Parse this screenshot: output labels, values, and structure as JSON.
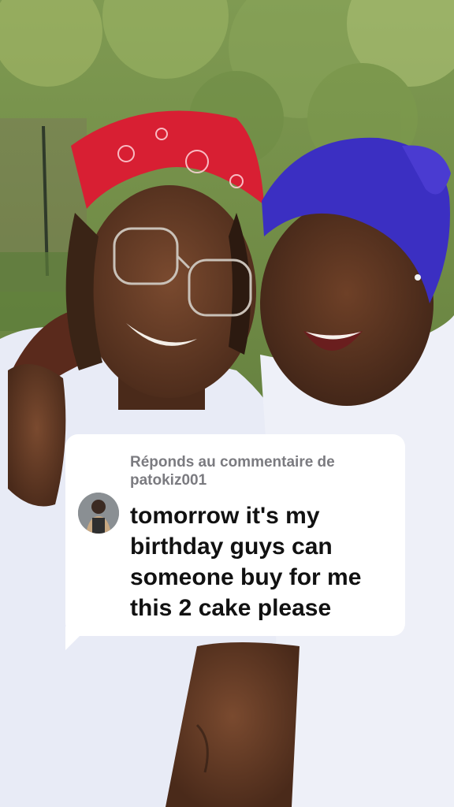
{
  "reply_card": {
    "header": "Réponds au commentaire de patokiz001",
    "comment": "tomorrow it's my birthday guys can someone buy for me this 2 cake please"
  },
  "colors": {
    "card_bg": "#ffffff",
    "header_text": "#7b7b80",
    "comment_text": "#111111",
    "bandana_red": "#d81f33",
    "headwrap_purple": "#3b2fc2",
    "shirt_white": "#eef0f8"
  },
  "icons": {
    "avatar": "user-avatar-photo"
  }
}
